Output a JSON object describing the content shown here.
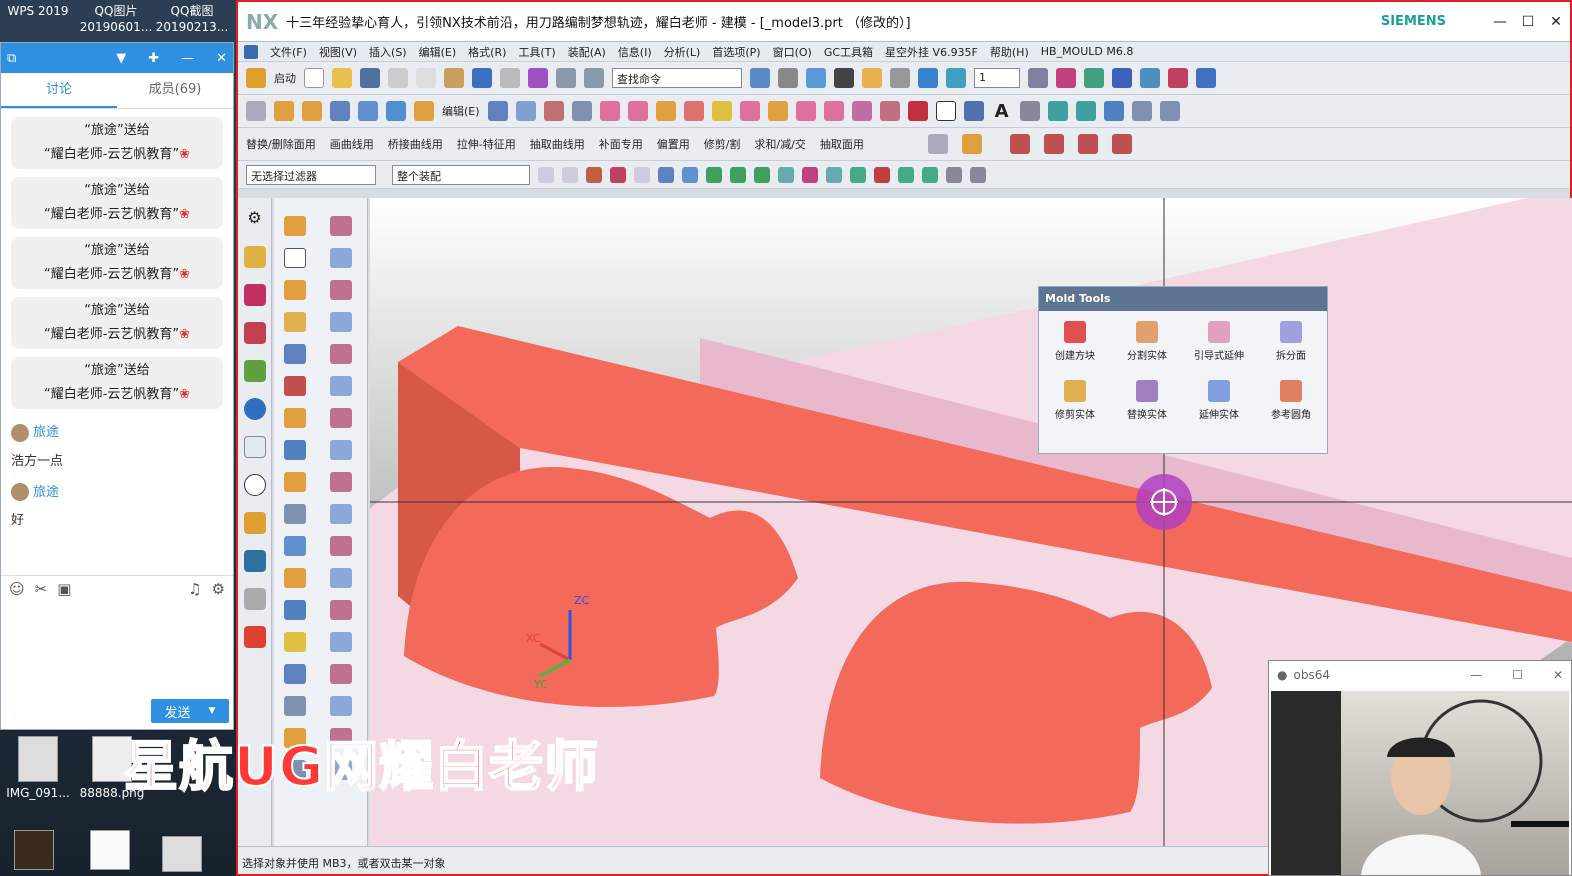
{
  "desktop": {
    "top_icons": [
      {
        "label": "WPS 2019",
        "sub": ""
      },
      {
        "label": "QQ图片",
        "sub": "20190601..."
      },
      {
        "label": "QQ截图",
        "sub": "20190213..."
      }
    ],
    "bottom_icons": [
      "IMG_091...",
      "88888.png"
    ]
  },
  "chat": {
    "tabs": [
      "讨论",
      "成员(69)"
    ],
    "gifts": [
      {
        "line1": "“旅途”送给",
        "line2": "“耀白老师-云艺帆教育”"
      },
      {
        "line1": "“旅途”送给",
        "line2": "“耀白老师-云艺帆教育”"
      },
      {
        "line1": "“旅途”送给",
        "line2": "“耀白老师-云艺帆教育”"
      },
      {
        "line1": "“旅途”送给",
        "line2": "“耀白老师-云艺帆教育”"
      },
      {
        "line1": "“旅途”送给",
        "line2": "“耀白老师-云艺帆教育”"
      }
    ],
    "messages": [
      {
        "name": "旅途",
        "text": "浩方一点"
      },
      {
        "name": "旅途",
        "text": "好"
      }
    ],
    "send_label": "发送"
  },
  "nx": {
    "logo": "NX",
    "title": "十三年经验挚心育人，引领NX技术前沿，用刀路编制梦想轨迹，耀白老师 - 建模 - [_model3.prt （修改的）]",
    "brand": "SIEMENS",
    "menu": [
      "文件(F)",
      "视图(V)",
      "插入(S)",
      "编辑(E)",
      "格式(R)",
      "工具(T)",
      "装配(A)",
      "信息(I)",
      "分析(L)",
      "首选项(P)",
      "窗口(O)",
      "GC工具箱",
      "星空外挂 V6.935F",
      "帮助(H)",
      "HB_MOULD M6.8"
    ],
    "start_label": "启动",
    "search_placeholder": "查找命令",
    "edit_label": "编辑(E)",
    "layer_value": "1",
    "row3": [
      "替换/删除面用",
      "画曲线用",
      "桥接曲线用",
      "拉伸-特征用",
      "抽取曲线用",
      "补面专用",
      "偏置用",
      "修剪/割",
      "求和/减/交",
      "抽取面用"
    ],
    "filter_value": "无选择过滤器",
    "scope_value": "整个装配",
    "status": "选择对象并使用 MB3，或者双击某一对象"
  },
  "mold": {
    "title": "Mold Tools",
    "items": [
      "创建方块",
      "分割实体",
      "引导式延伸",
      "拆分面",
      "修剪实体",
      "替换实体",
      "延伸实体",
      "参考圆角"
    ]
  },
  "axes": {
    "z": "ZC",
    "x": "XC",
    "y": "YC"
  },
  "obs": {
    "title": "obs64"
  },
  "banner": "星航UG网耀白老师",
  "colors": {
    "part": "#f36a5a",
    "mold_base": "#f4d8e4",
    "accent": "#2f8fe0",
    "banner": "#ff3838"
  }
}
